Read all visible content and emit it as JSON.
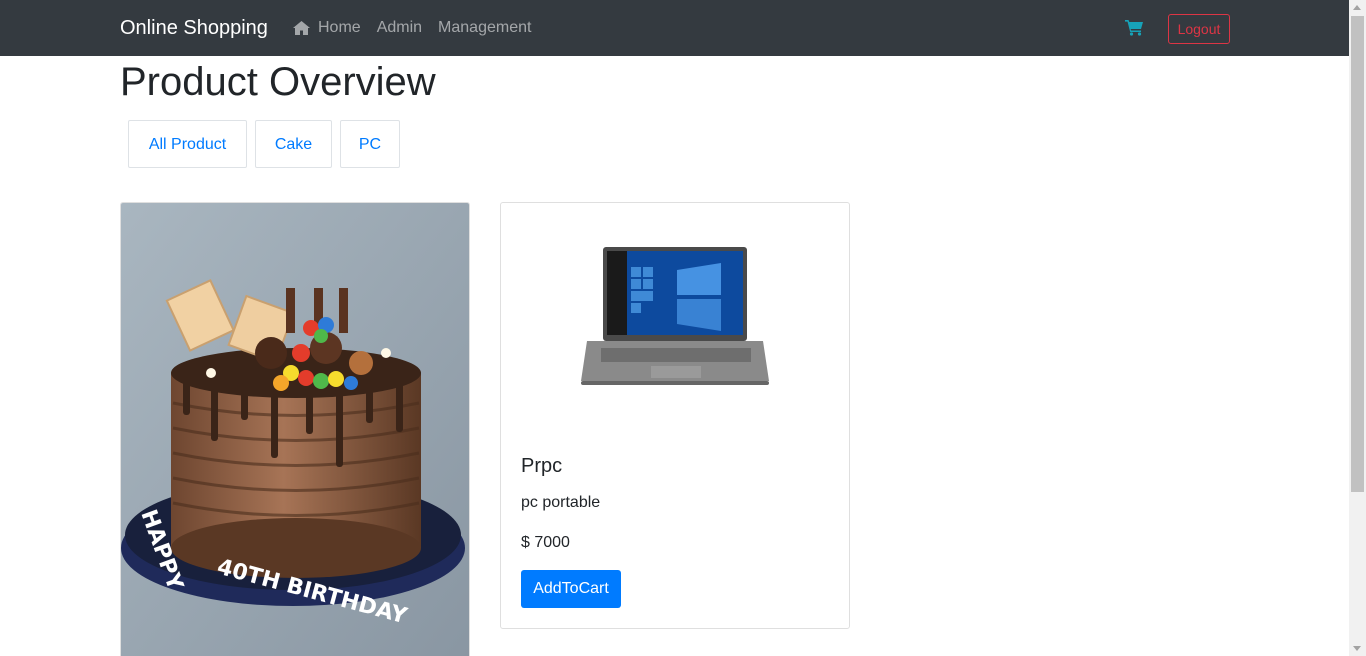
{
  "navbar": {
    "brand": "Online Shopping",
    "links": [
      {
        "label": "Home",
        "icon": "home-icon"
      },
      {
        "label": "Admin"
      },
      {
        "label": "Management"
      }
    ],
    "cart_icon": "shopping-cart-icon",
    "cart_color": "#17a2b8",
    "logout_label": "Logout"
  },
  "page": {
    "title": "Product Overview"
  },
  "filters": [
    "All Product",
    "Cake",
    "PC"
  ],
  "products": [
    {
      "image": "chocolate-birthday-cake-image",
      "cake_lettering": "HAPPY 40TH BIRTHDAY"
    },
    {
      "image": "laptop-image",
      "name": "Prpc",
      "description": "pc portable",
      "price": "$ 7000",
      "button": "AddToCart"
    }
  ],
  "colors": {
    "primary": "#007bff",
    "danger": "#dc3545",
    "navbar_bg": "#343a40"
  }
}
